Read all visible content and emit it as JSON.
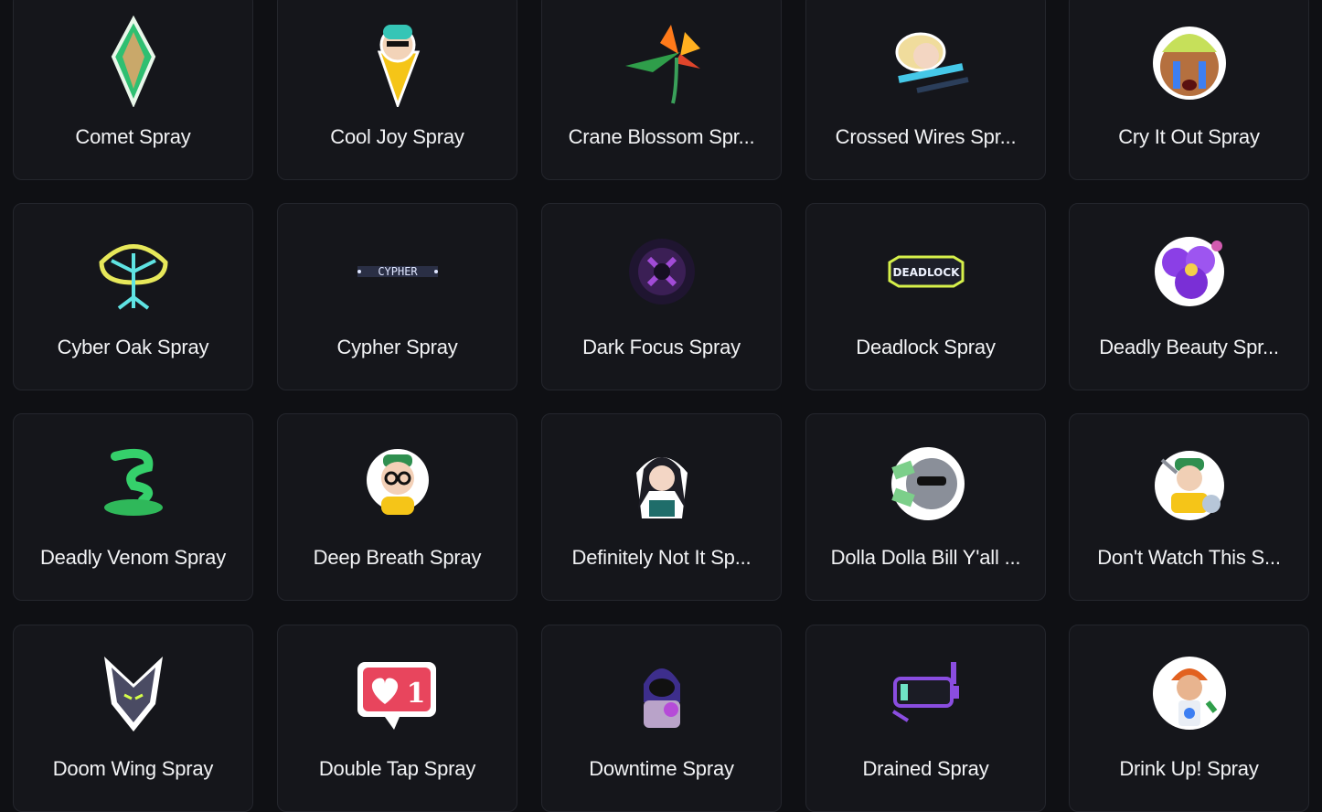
{
  "sprays": [
    {
      "label": "Comet Spray",
      "icon": "comet-icon"
    },
    {
      "label": "Cool Joy Spray",
      "icon": "cool-joy-icon"
    },
    {
      "label": "Crane Blossom Spr...",
      "icon": "crane-blossom-icon"
    },
    {
      "label": "Crossed Wires Spr...",
      "icon": "crossed-wires-icon"
    },
    {
      "label": "Cry It Out Spray",
      "icon": "cry-it-out-icon"
    },
    {
      "label": "Cyber Oak Spray",
      "icon": "cyber-oak-icon"
    },
    {
      "label": "Cypher Spray",
      "icon": "cypher-icon"
    },
    {
      "label": "Dark Focus Spray",
      "icon": "dark-focus-icon"
    },
    {
      "label": "Deadlock Spray",
      "icon": "deadlock-icon"
    },
    {
      "label": "Deadly Beauty Spr...",
      "icon": "deadly-beauty-icon"
    },
    {
      "label": "Deadly Venom Spray",
      "icon": "deadly-venom-icon"
    },
    {
      "label": "Deep Breath Spray",
      "icon": "deep-breath-icon"
    },
    {
      "label": "Definitely Not It Sp...",
      "icon": "definitely-not-it-icon"
    },
    {
      "label": "Dolla Dolla Bill Y'all ...",
      "icon": "dolla-dolla-bill-icon"
    },
    {
      "label": "Don't Watch This S...",
      "icon": "dont-watch-this-icon"
    },
    {
      "label": "Doom Wing Spray",
      "icon": "doom-wing-icon"
    },
    {
      "label": "Double Tap Spray",
      "icon": "double-tap-icon"
    },
    {
      "label": "Downtime Spray",
      "icon": "downtime-icon"
    },
    {
      "label": "Drained Spray",
      "icon": "drained-icon"
    },
    {
      "label": "Drink Up! Spray",
      "icon": "drink-up-icon"
    }
  ],
  "colors": {
    "background": "#0f1014",
    "card": "#15161b",
    "card_border": "#24262d",
    "text": "#f2f3f5"
  }
}
